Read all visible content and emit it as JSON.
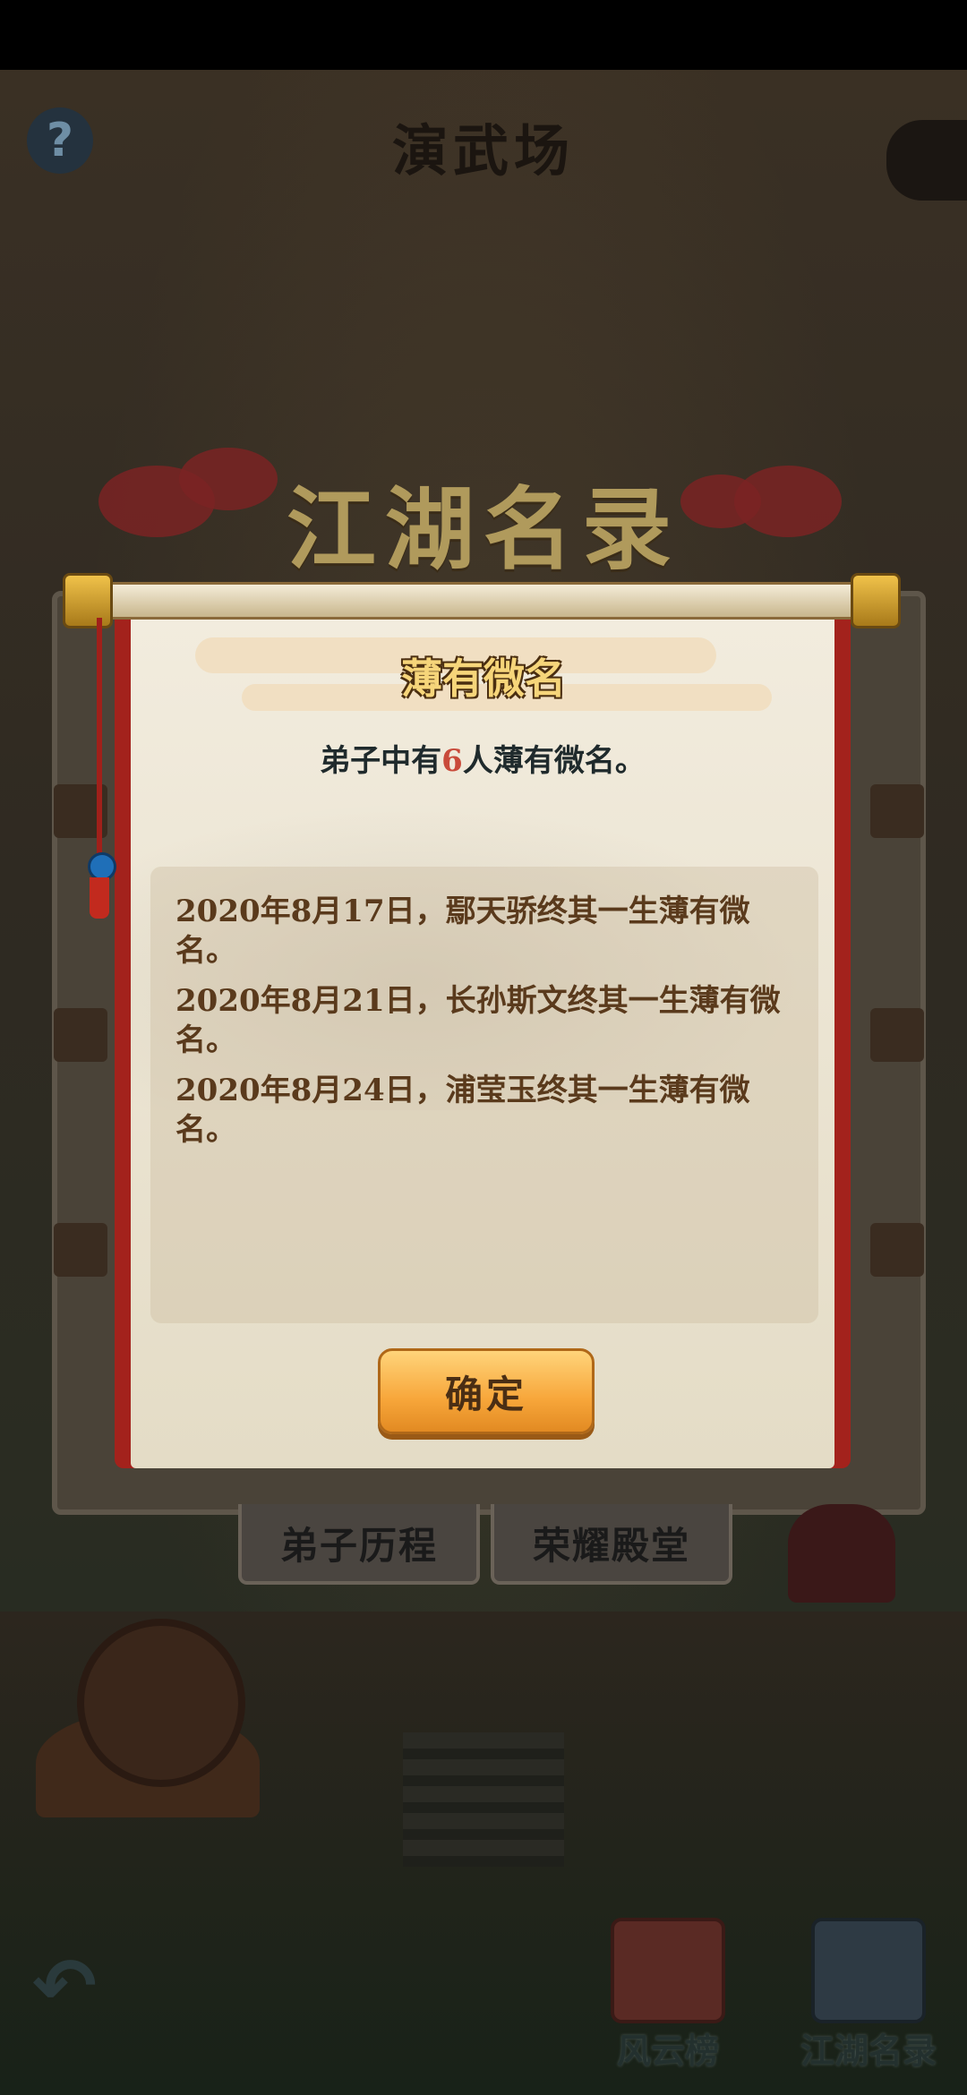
{
  "screen": {
    "title": "演武场",
    "help_label": "?",
    "banner_title": "江湖名录"
  },
  "dialog": {
    "title": "薄有微名",
    "summary_prefix": "弟子中有",
    "summary_count": "6",
    "summary_suffix": "人薄有微名。",
    "records": [
      "2020年8月17日，鄢天骄终其一生薄有微名。",
      "2020年8月21日，长孙斯文终其一生薄有微名。",
      "2020年8月24日，浦莹玉终其一生薄有微名。"
    ],
    "confirm_label": "确定"
  },
  "panel_tabs": {
    "disciple_history": "弟子历程",
    "hall_of_fame": "荣耀殿堂"
  },
  "bottom_nav": {
    "back_icon": "back-arrow-icon",
    "items": [
      {
        "label": "风云榜",
        "icon": "ranking-scroll-icon"
      },
      {
        "label": "江湖名录",
        "icon": "book-icon"
      }
    ]
  },
  "colors": {
    "dialog_red": "#a3221c",
    "paper": "#f2ecde",
    "title_gold": "#f6d57a",
    "count_red": "#c94a3a",
    "record_brown": "#5a3a1c",
    "button_orange": "#f7a63a"
  }
}
